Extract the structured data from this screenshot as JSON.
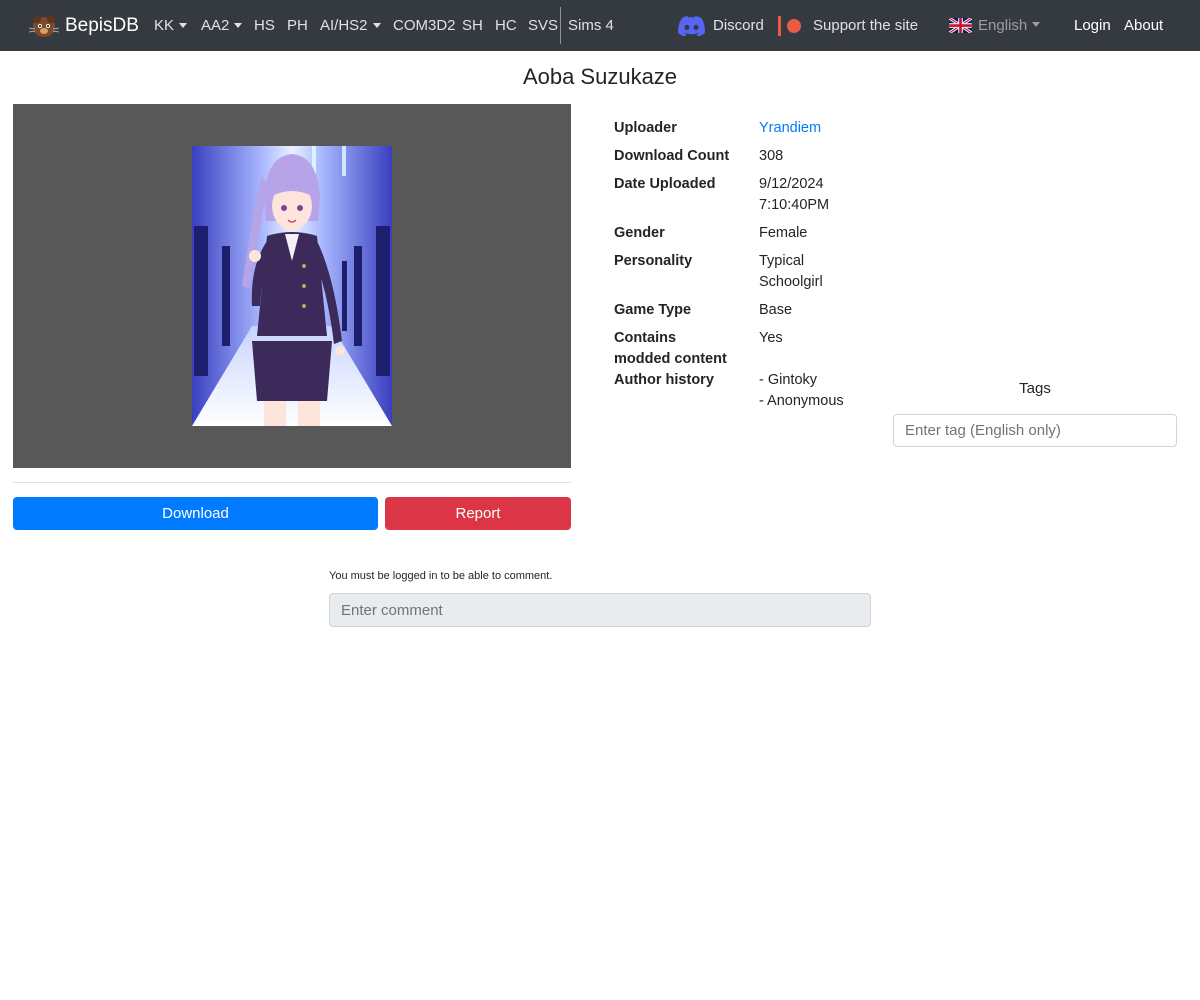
{
  "navbar": {
    "brand": "BepisDB",
    "items": [
      {
        "label": "KK",
        "dropdown": true
      },
      {
        "label": "AA2",
        "dropdown": true
      },
      {
        "label": "HS",
        "dropdown": false
      },
      {
        "label": "PH",
        "dropdown": false
      },
      {
        "label": "AI/HS2",
        "dropdown": true
      },
      {
        "label": "COM3D2",
        "dropdown": false
      },
      {
        "label": "SH",
        "dropdown": false
      },
      {
        "label": "HC",
        "dropdown": false
      },
      {
        "label": "SVS",
        "dropdown": false
      },
      {
        "label": "Sims 4",
        "dropdown": false
      }
    ],
    "discord": "Discord",
    "support": "Support the site",
    "language": "English",
    "login": "Login",
    "about": "About"
  },
  "card": {
    "title": "Aoba Suzukaze",
    "download_label": "Download",
    "report_label": "Report"
  },
  "info": {
    "uploader_label": "Uploader",
    "uploader": "Yrandiem",
    "download_count_label": "Download Count",
    "download_count": "308",
    "date_uploaded_label": "Date Uploaded",
    "date_uploaded_line1": "9/12/2024",
    "date_uploaded_line2": "7:10:40PM",
    "gender_label": "Gender",
    "gender": "Female",
    "personality_label": "Personality",
    "personality_line1": "Typical",
    "personality_line2": "Schoolgirl",
    "game_type_label": "Game Type",
    "game_type": "Base",
    "modded_label_line1": "Contains",
    "modded_label_line2": "modded content",
    "modded": "Yes",
    "author_history_label": "Author history",
    "author_history": [
      "- Gintoky",
      "- Anonymous"
    ]
  },
  "tags": {
    "title": "Tags",
    "placeholder": "Enter tag (English only)"
  },
  "comments": {
    "note": "You must be logged in to be able to comment.",
    "placeholder": "Enter comment"
  },
  "colors": {
    "navbar_bg": "#343a40",
    "primary": "#007bff",
    "danger": "#dc3545",
    "patreon": "#e85b46",
    "discord": "#5865f2"
  }
}
